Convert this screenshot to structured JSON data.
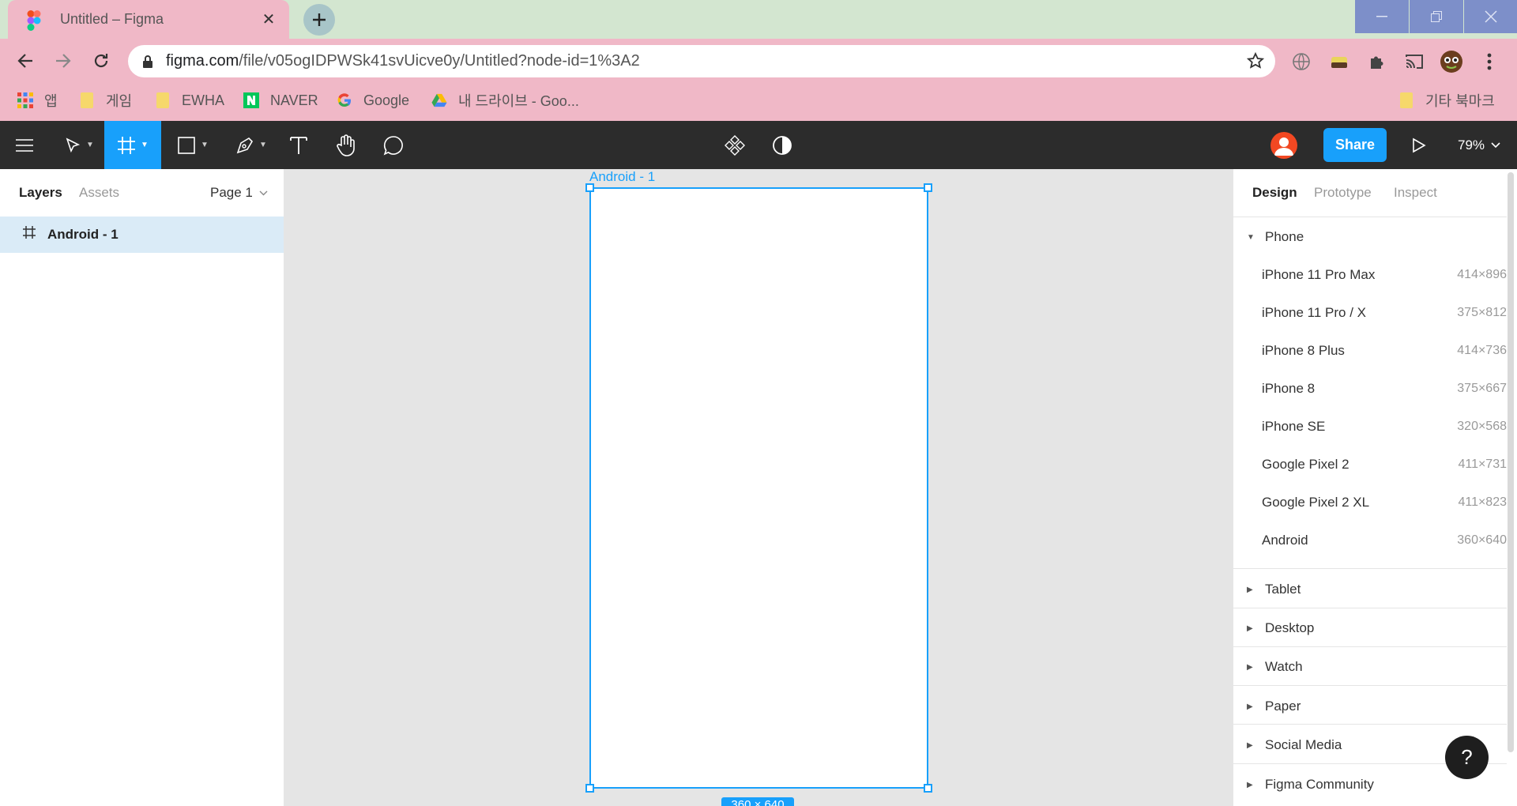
{
  "browser": {
    "tab_title": "Untitled – Figma",
    "tab_close_icon": "close-icon",
    "url_host": "figma.com",
    "url_path": "/file/v05ogIDPWSk41svUicve0y/Untitled?node-id=1%3A2"
  },
  "bookmarks": [
    {
      "label": "앱",
      "icon": "apps-grid-icon"
    },
    {
      "label": "게임",
      "icon": "folder-icon"
    },
    {
      "label": "EWHA",
      "icon": "folder-icon"
    },
    {
      "label": "NAVER",
      "icon": "naver-icon"
    },
    {
      "label": "Google",
      "icon": "google-icon"
    },
    {
      "label": "내 드라이브 - Goo...",
      "icon": "drive-icon"
    }
  ],
  "bookmarks_other": "기타 북마크",
  "figma_toolbar": {
    "share_label": "Share",
    "zoom_label": "79%"
  },
  "left_panel": {
    "tab_layers": "Layers",
    "tab_assets": "Assets",
    "page_label": "Page 1",
    "layers": [
      {
        "name": "Android - 1",
        "selected": true
      }
    ]
  },
  "canvas": {
    "frame_label": "Android - 1",
    "size_badge": "360 × 640"
  },
  "right_panel": {
    "tab_design": "Design",
    "tab_prototype": "Prototype",
    "tab_inspect": "Inspect",
    "expanded_section": "Phone",
    "devices": [
      {
        "name": "iPhone 11 Pro Max",
        "size": "414×896"
      },
      {
        "name": "iPhone 11 Pro / X",
        "size": "375×812"
      },
      {
        "name": "iPhone 8 Plus",
        "size": "414×736"
      },
      {
        "name": "iPhone 8",
        "size": "375×667"
      },
      {
        "name": "iPhone SE",
        "size": "320×568"
      },
      {
        "name": "Google Pixel 2",
        "size": "411×731"
      },
      {
        "name": "Google Pixel 2 XL",
        "size": "411×823"
      },
      {
        "name": "Android",
        "size": "360×640"
      }
    ],
    "collapsed_sections": [
      "Tablet",
      "Desktop",
      "Watch",
      "Paper",
      "Social Media",
      "Figma Community"
    ]
  },
  "help_label": "?",
  "colors": {
    "accent": "#18a0fb",
    "toolbar_bg": "#2c2c2c",
    "browser_pink": "#f0b8c7"
  }
}
